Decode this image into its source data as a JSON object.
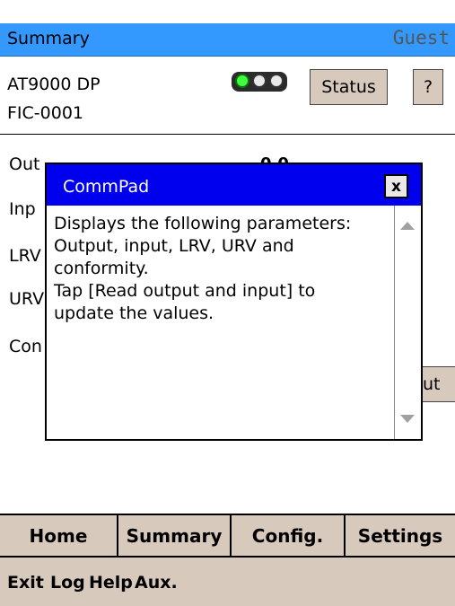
{
  "header": {
    "title": "Summary",
    "user": "Guest"
  },
  "device": {
    "model": "AT9000 DP",
    "tag": "FIC-0001",
    "status_label": "Status",
    "help_label": "?"
  },
  "params": {
    "output": "Out",
    "input": "Inp",
    "lrv": "LRV",
    "urv": "URV",
    "conformity": "Con",
    "output_value_partial": "0.0",
    "read_button_partial": "ut"
  },
  "dialog": {
    "title": "CommPad",
    "close": "x",
    "text_line1": "Displays the following parameters:",
    "text_line2": "Output, input, LRV, URV and",
    "text_line3": "conformity.",
    "text_line4": "Tap [Read output and input] to",
    "text_line5": "update the values."
  },
  "tabs": [
    "Home",
    "Summary",
    "Config.",
    "Settings"
  ],
  "menu": [
    "Exit",
    "Log",
    "Help",
    "Aux."
  ],
  "colors": {
    "header": "#3399ff",
    "dialog_caption": "#0000ee",
    "button": "#d8c9bd",
    "status_light": "#40ff40"
  }
}
